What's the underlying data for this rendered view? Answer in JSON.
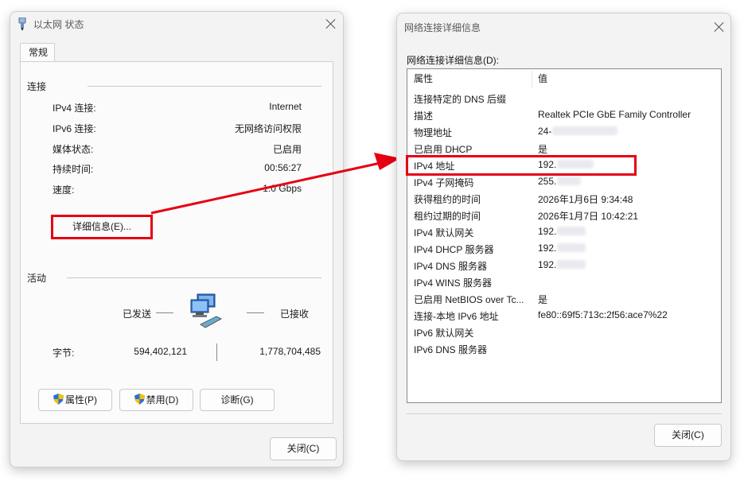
{
  "status_window": {
    "title": "以太网 状态",
    "tab": "常规",
    "connection_group": "连接",
    "rows": [
      {
        "label": "IPv4 连接:",
        "value": "Internet"
      },
      {
        "label": "IPv6 连接:",
        "value": "无网络访问权限"
      },
      {
        "label": "媒体状态:",
        "value": "已启用"
      },
      {
        "label": "持续时间:",
        "value": "00:56:27"
      },
      {
        "label": "速度:",
        "value": "1.0 Gbps"
      }
    ],
    "details_button": "详细信息(E)...",
    "activity_group": "活动",
    "sent_label": "已发送",
    "received_label": "已接收",
    "bytes_label": "字节:",
    "bytes_sent": "594,402,121",
    "bytes_received": "1,778,704,485",
    "properties_button": "属性(P)",
    "disable_button": "禁用(D)",
    "diagnose_button": "诊断(G)",
    "close_button": "关闭(C)"
  },
  "details_window": {
    "title": "网络连接详细信息",
    "list_label": "网络连接详细信息(D):",
    "col_property": "属性",
    "col_value": "值",
    "rows": [
      {
        "property": "连接特定的 DNS 后缀",
        "value": ""
      },
      {
        "property": "描述",
        "value": "Realtek PCIe GbE Family Controller"
      },
      {
        "property": "物理地址",
        "value": "24-"
      },
      {
        "property": "已启用 DHCP",
        "value": "是"
      },
      {
        "property": "IPv4 地址",
        "value": "192."
      },
      {
        "property": "IPv4 子网掩码",
        "value": "255."
      },
      {
        "property": "获得租约的时间",
        "value": "2026年1月6日 9:34:48"
      },
      {
        "property": "租约过期的时间",
        "value": "2026年1月7日 10:42:21"
      },
      {
        "property": "IPv4 默认网关",
        "value": "192."
      },
      {
        "property": "IPv4 DHCP 服务器",
        "value": "192."
      },
      {
        "property": "IPv4 DNS 服务器",
        "value": "192."
      },
      {
        "property": "IPv4 WINS 服务器",
        "value": ""
      },
      {
        "property": "已启用 NetBIOS over Tc...",
        "value": "是"
      },
      {
        "property": "连接-本地 IPv6 地址",
        "value": "fe80::69f5:713c:2f56:ace7%22"
      },
      {
        "property": "IPv6 默认网关",
        "value": ""
      },
      {
        "property": "IPv6 DNS 服务器",
        "value": ""
      }
    ],
    "close_button": "关闭(C)"
  },
  "colors": {
    "highlight": "#e60012",
    "shield_blue": "#2a6fdb",
    "shield_yellow": "#f2c200"
  },
  "icons": [
    "network-adapter-icon",
    "computer-network-icon",
    "shield-icon",
    "close-icon"
  ]
}
